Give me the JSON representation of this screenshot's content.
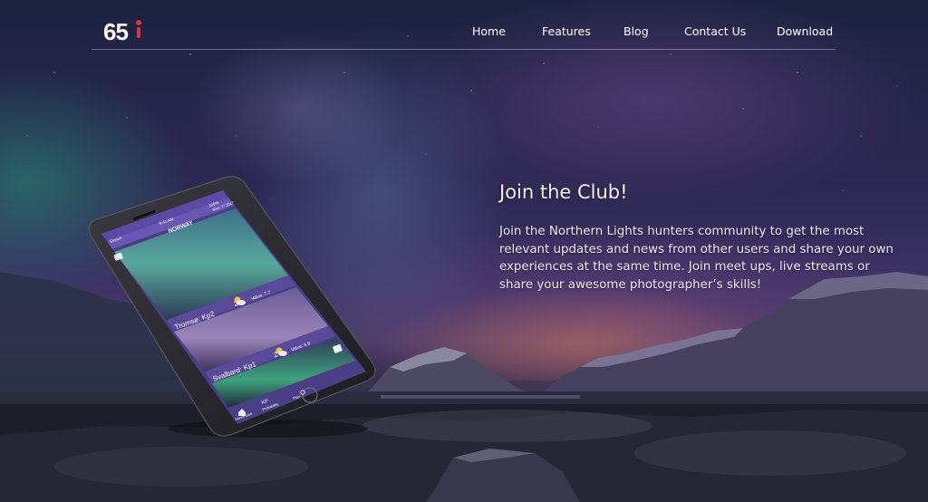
{
  "brand": {
    "logo_text": "65"
  },
  "nav": {
    "items": [
      {
        "label": "Home"
      },
      {
        "label": "Features"
      },
      {
        "label": "Blog"
      },
      {
        "label": "Contact Us"
      },
      {
        "label": "Download"
      }
    ]
  },
  "hero": {
    "title": "Join the Club!",
    "body": "Join the Northern Lights hunters community to get the most relevant updates and news from other users and share your own experiences at the same time. Join meet ups, live streams or share your awesome photographer’s skills!"
  },
  "phone_screen": {
    "status_carrier": "Sketch",
    "status_time": "9:41 AM",
    "status_battery": "100%",
    "date": "Mon, 27.2017",
    "header": "NORWAY",
    "cards": [
      {
        "location": "Tromsø: Kp2",
        "temp": "2°",
        "detail": "Value: 7.7"
      },
      {
        "location": "Svalbard: Kp1",
        "temp": "2°",
        "detail": "Value: 6.8"
      }
    ],
    "tabbar": [
      {
        "label": "Home feed",
        "icon": "home-icon"
      },
      {
        "label": "Probability",
        "icon": "kp-icon",
        "text": "KP"
      },
      {
        "label": "Plan",
        "icon": "compass-icon"
      }
    ]
  },
  "colors": {
    "accent_red": "#e0343d",
    "screen_purple": "#5d4aa6"
  }
}
